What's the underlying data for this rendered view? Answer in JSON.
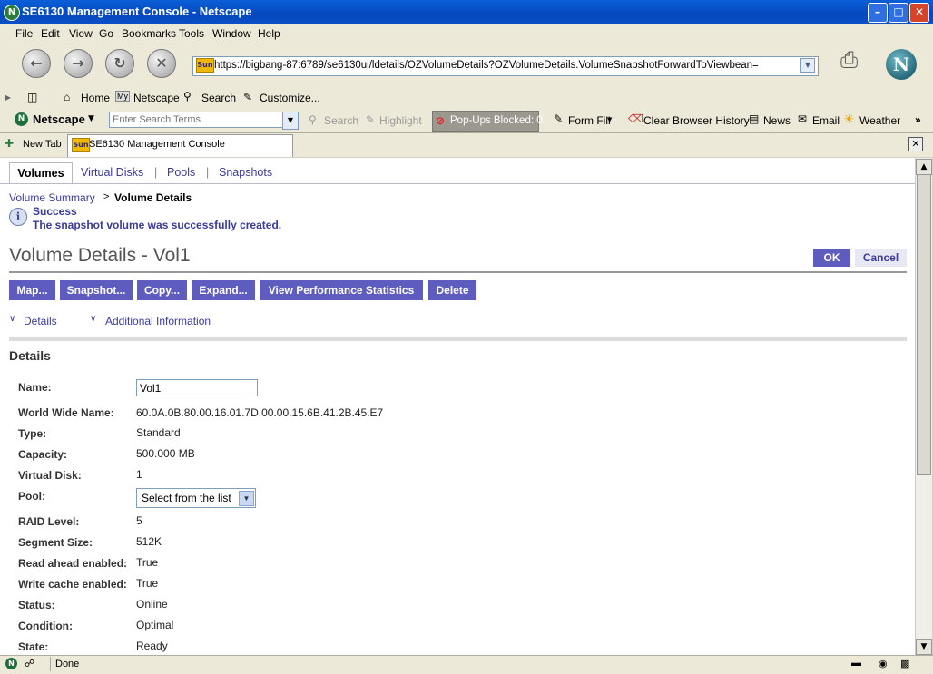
{
  "window": {
    "title": "SE6130 Management Console - Netscape"
  },
  "menu": [
    "File",
    "Edit",
    "View",
    "Go",
    "Bookmarks",
    "Tools",
    "Window",
    "Help"
  ],
  "nav": {
    "url": "https://bigbang-87:6789/se6130ui/ldetails/OZVolumeDetails?OZVolumeDetails.VolumeSnapshotForwardToViewbean=",
    "sun_badge": "Sun"
  },
  "personal_toolbar": {
    "home": "Home",
    "netscape": "Netscape",
    "search": "Search",
    "customize": "Customize..."
  },
  "search_toolbar": {
    "brand": "Netscape",
    "placeholder": "Enter Search Terms",
    "search": "Search",
    "highlight": "Highlight",
    "popups": "Pop-Ups Blocked: 0",
    "form_fill": "Form Fill",
    "clear_history": "Clear Browser History",
    "news": "News",
    "email": "Email",
    "weather": "Weather"
  },
  "tabs": {
    "new_tab": "New Tab",
    "active_tab": "SE6130 Management Console"
  },
  "page": {
    "tabs": [
      "Volumes",
      "Virtual Disks",
      "Pools",
      "Snapshots"
    ],
    "breadcrumb": {
      "parent": "Volume Summary",
      "sep": ">",
      "current": "Volume Details"
    },
    "alert": {
      "title": "Success",
      "message": "The snapshot volume was successfully created."
    },
    "title": "Volume Details - Vol1",
    "ok": "OK",
    "cancel": "Cancel",
    "actions": [
      "Map...",
      "Snapshot...",
      "Copy...",
      "Expand...",
      "View Performance Statistics",
      "Delete"
    ],
    "jump_links": [
      "Details",
      "Additional Information"
    ],
    "section_title": "Details",
    "fields": [
      {
        "label": "Name:",
        "value": "Vol1"
      },
      {
        "label": "World Wide Name:",
        "value": "60.0A.0B.80.00.16.01.7D.00.00.15.6B.41.2B.45.E7"
      },
      {
        "label": "Type:",
        "value": "Standard"
      },
      {
        "label": "Capacity:",
        "value": "500.000 MB"
      },
      {
        "label": "Virtual Disk:",
        "value": "1"
      },
      {
        "label": "Pool:",
        "value": "Select from the list"
      },
      {
        "label": "RAID Level:",
        "value": "5"
      },
      {
        "label": "Segment Size:",
        "value": "512K"
      },
      {
        "label": "Read ahead enabled:",
        "value": "True"
      },
      {
        "label": "Write cache enabled:",
        "value": "True"
      },
      {
        "label": "Status:",
        "value": "Online"
      },
      {
        "label": "Condition:",
        "value": "Optimal"
      },
      {
        "label": "State:",
        "value": "Ready"
      }
    ]
  },
  "status": {
    "text": "Done"
  },
  "colors": {
    "accent": "#5f5cc0",
    "link": "#3a3a9e",
    "titlebar": "#0648bd"
  }
}
